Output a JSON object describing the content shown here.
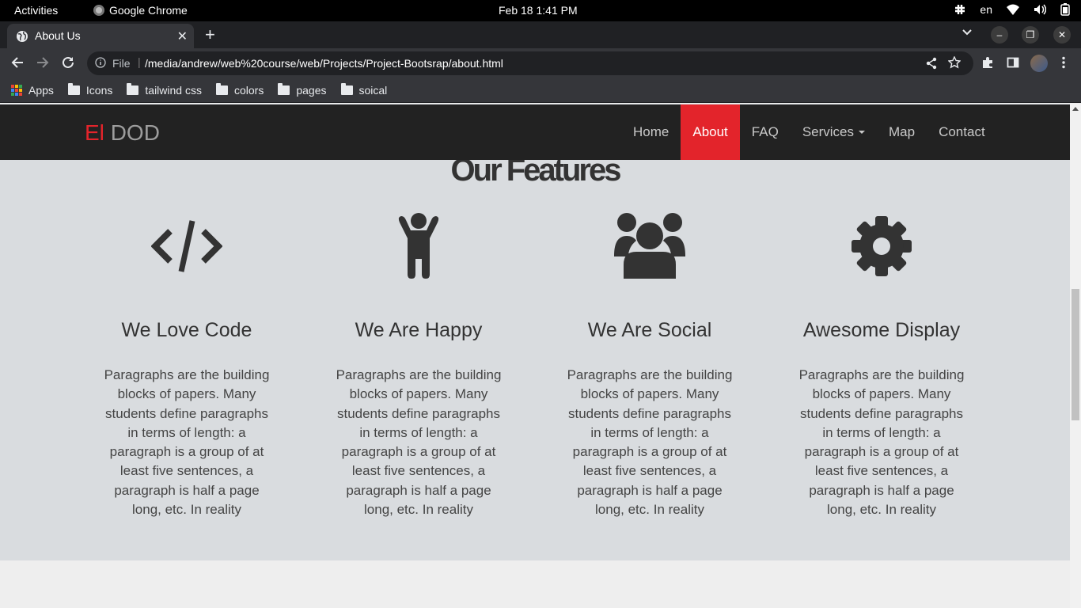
{
  "os": {
    "activities": "Activities",
    "app_name": "Google Chrome",
    "clock": "Feb 18  1:41 PM",
    "language": "en"
  },
  "browser": {
    "tab_title": "About Us",
    "address_prefix": "File",
    "url": "/media/andrew/web%20course/web/Projects/Project-Bootsrap/about.html",
    "bookmarks": [
      "Apps",
      "Icons",
      "tailwind css",
      "colors",
      "pages",
      "soical"
    ]
  },
  "site": {
    "brand_accent": "El",
    "brand_rest": "DOD",
    "nav": [
      {
        "label": "Home"
      },
      {
        "label": "About",
        "active": true
      },
      {
        "label": "FAQ"
      },
      {
        "label": "Services",
        "dropdown": true
      },
      {
        "label": "Map"
      },
      {
        "label": "Contact"
      }
    ],
    "features_title": "Our Features",
    "features": [
      {
        "icon": "code-icon",
        "title": "We Love Code",
        "text": "Paragraphs are the building blocks of papers. Many students define paragraphs in terms of length: a paragraph is a group of at least five sentences, a paragraph is half a page long, etc. In reality"
      },
      {
        "icon": "child-icon",
        "title": "We Are Happy",
        "text": "Paragraphs are the building blocks of papers. Many students define paragraphs in terms of length: a paragraph is a group of at least five sentences, a paragraph is half a page long, etc. In reality"
      },
      {
        "icon": "users-icon",
        "title": "We Are Social",
        "text": "Paragraphs are the building blocks of papers. Many students define paragraphs in terms of length: a paragraph is a group of at least five sentences, a paragraph is half a page long, etc. In reality"
      },
      {
        "icon": "gear-icon",
        "title": "Awesome Display",
        "text": "Paragraphs are the building blocks of papers. Many students define paragraphs in terms of length: a paragraph is a group of at least five sentences, a paragraph is half a page long, etc. In reality"
      }
    ]
  },
  "colors": {
    "accent": "#e3242b",
    "navbar": "#222222",
    "features_bg": "#d9dcdf"
  }
}
